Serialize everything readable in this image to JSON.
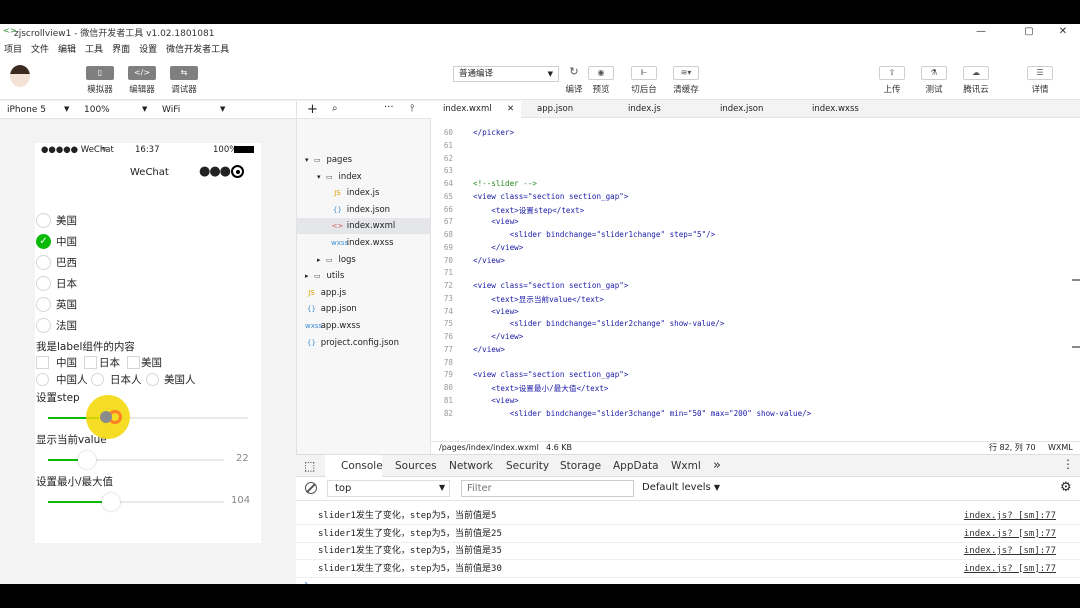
{
  "window": {
    "title": "zjscrollview1 - 微信开发者工具 v1.02.1801081"
  },
  "menu": [
    "项目",
    "文件",
    "编辑",
    "工具",
    "界面",
    "设置",
    "微信开发者工具"
  ],
  "toolbar": {
    "left": [
      {
        "label": "模拟器",
        "icon": "phone-icon"
      },
      {
        "label": "编辑器",
        "icon": "code-icon"
      },
      {
        "label": "调试器",
        "icon": "debug-icon"
      }
    ],
    "compile_mode": "普通编译",
    "mid": [
      {
        "label": "编译",
        "icon": "refresh-icon"
      },
      {
        "label": "预览",
        "icon": "eye-icon"
      },
      {
        "label": "切后台",
        "icon": "switch-icon"
      },
      {
        "label": "清缓存",
        "icon": "layers-icon"
      }
    ],
    "right": [
      {
        "label": "上传",
        "icon": "upload-icon"
      },
      {
        "label": "测试",
        "icon": "flask-icon"
      },
      {
        "label": "腾讯云",
        "icon": "cloud-icon"
      },
      {
        "label": "详情",
        "icon": "menu-icon"
      }
    ]
  },
  "simulator": {
    "device": "iPhone 5",
    "zoom": "100%",
    "network": "WiFi"
  },
  "phone": {
    "carrier": "●●●●● WeChat",
    "time": "16:37",
    "battery": "100%",
    "nav_title": "WeChat",
    "radios": [
      {
        "label": "美国",
        "checked": false
      },
      {
        "label": "中国",
        "checked": true
      },
      {
        "label": "巴西",
        "checked": false
      },
      {
        "label": "日本",
        "checked": false
      },
      {
        "label": "英国",
        "checked": false
      },
      {
        "label": "法国",
        "checked": false
      }
    ],
    "label_text": "我是label组件的内容",
    "checks_row1": [
      "中国",
      "日本",
      "美国"
    ],
    "checks_row2": [
      "中国人",
      "日本人",
      "美国人"
    ],
    "step_label": "设置step",
    "value_label": "显示当前value",
    "minmax_label": "设置最小/最大值",
    "slider1": {
      "value": 30,
      "min": 0,
      "max": 100
    },
    "slider2": {
      "value": 22,
      "min": 0,
      "max": 100,
      "shown": "22"
    },
    "slider3": {
      "value": 104,
      "min": 50,
      "max": 200,
      "shown": "104"
    }
  },
  "explorer": {
    "items": [
      {
        "name": "pages",
        "kind": "folder-open",
        "depth": 0
      },
      {
        "name": "index",
        "kind": "folder-open",
        "depth": 1
      },
      {
        "name": "index.js",
        "kind": "js",
        "depth": 2
      },
      {
        "name": "index.json",
        "kind": "json",
        "depth": 2
      },
      {
        "name": "index.wxml",
        "kind": "wxml",
        "depth": 2,
        "selected": true
      },
      {
        "name": "index.wxss",
        "kind": "wxss",
        "depth": 2
      },
      {
        "name": "logs",
        "kind": "folder",
        "depth": 1
      },
      {
        "name": "utils",
        "kind": "folder",
        "depth": 0
      },
      {
        "name": "app.js",
        "kind": "js",
        "depth": 0
      },
      {
        "name": "app.json",
        "kind": "json",
        "depth": 0
      },
      {
        "name": "app.wxss",
        "kind": "wxss",
        "depth": 0
      },
      {
        "name": "project.config.json",
        "kind": "json",
        "depth": 0
      }
    ]
  },
  "editor": {
    "tabs": [
      "index.wxml",
      "app.json",
      "index.js",
      "index.json",
      "index.wxss"
    ],
    "lines": [
      {
        "n": "60",
        "t": "</picker>"
      },
      {
        "n": "61",
        "t": ""
      },
      {
        "n": "62",
        "t": ""
      },
      {
        "n": "63",
        "t": ""
      },
      {
        "n": "64",
        "t": "<!--slider -->"
      },
      {
        "n": "65",
        "t": "<view class=\"section section_gap\">"
      },
      {
        "n": "66",
        "t": "    <text>设置step</text>"
      },
      {
        "n": "67",
        "t": "    <view>"
      },
      {
        "n": "68",
        "t": "        <slider bindchange=\"slider1change\" step=\"5\"/>"
      },
      {
        "n": "69",
        "t": "    </view>"
      },
      {
        "n": "70",
        "t": "</view>"
      },
      {
        "n": "71",
        "t": ""
      },
      {
        "n": "72",
        "t": "<view class=\"section section_gap\">"
      },
      {
        "n": "73",
        "t": "    <text>显示当前value</text>"
      },
      {
        "n": "74",
        "t": "    <view>"
      },
      {
        "n": "75",
        "t": "        <slider bindchange=\"slider2change\" show-value/>"
      },
      {
        "n": "76",
        "t": "    </view>"
      },
      {
        "n": "77",
        "t": "</view>"
      },
      {
        "n": "78",
        "t": ""
      },
      {
        "n": "79",
        "t": "<view class=\"section section_gap\">"
      },
      {
        "n": "80",
        "t": "    <text>设置最小/最大值</text>"
      },
      {
        "n": "81",
        "t": "    <view>"
      },
      {
        "n": "82",
        "t": "        <slider bindchange=\"slider3change\" min=\"50\" max=\"200\" show-value/>"
      }
    ],
    "path": "/pages/index/index.wxml",
    "size": "4.6 KB",
    "cursor": "行 82, 列 70",
    "lang": "WXML"
  },
  "devtools": {
    "tabs": [
      "Console",
      "Sources",
      "Network",
      "Security",
      "Storage",
      "AppData",
      "Wxml"
    ],
    "more": "»",
    "context": "top",
    "filter_placeholder": "Filter",
    "levels": "Default levels",
    "logs": [
      {
        "msg": "slider1发生了变化，step为5，当前值是5",
        "src": "index.js? [sm]:77"
      },
      {
        "msg": "slider1发生了变化，step为5，当前值是25",
        "src": "index.js? [sm]:77"
      },
      {
        "msg": "slider1发生了变化，step为5，当前值是35",
        "src": "index.js? [sm]:77"
      },
      {
        "msg": "slider1发生了变化，step为5，当前值是30",
        "src": "index.js? [sm]:77"
      }
    ],
    "prompt": "›"
  },
  "colors": {
    "accent": "#09bb07",
    "touch": "#f5d800",
    "touch_ring": "#ff6a00"
  }
}
